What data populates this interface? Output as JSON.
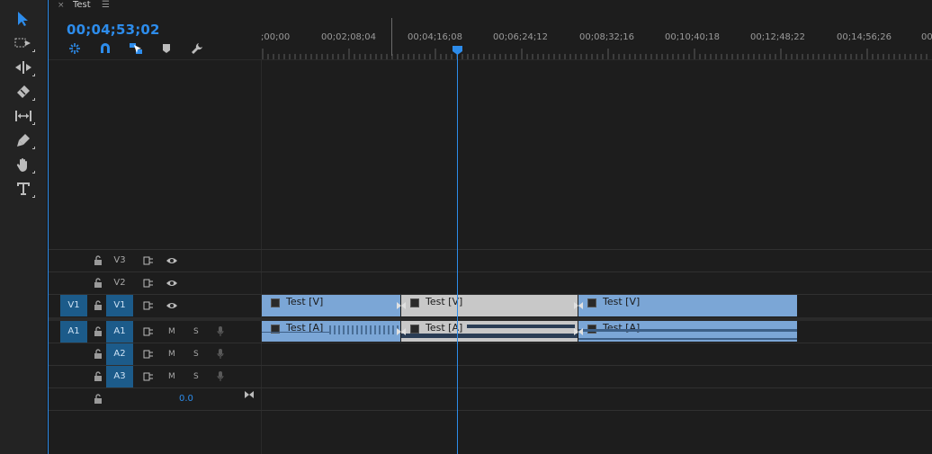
{
  "tools": [
    {
      "name": "selection-tool",
      "active": true
    },
    {
      "name": "track-select-tool",
      "active": false
    },
    {
      "name": "ripple-edit-tool",
      "active": false
    },
    {
      "name": "razor-tool",
      "active": false
    },
    {
      "name": "slip-tool",
      "active": false
    },
    {
      "name": "pen-tool",
      "active": false
    },
    {
      "name": "hand-tool",
      "active": false
    },
    {
      "name": "type-tool",
      "active": false
    }
  ],
  "panel": {
    "close_glyph": "×",
    "title": "Test",
    "menu_glyph": "☰"
  },
  "timecode": "00;04;53;02",
  "ruler": {
    "labels": [
      ";00;00",
      "00;02;08;04",
      "00;04;16;08",
      "00;06;24;12",
      "00;08;32;16",
      "00;10;40;18",
      "00;12;48;22",
      "00;14;56;26",
      "00"
    ]
  },
  "tracks": {
    "video": [
      {
        "label": "V3",
        "source": ""
      },
      {
        "label": "V2",
        "source": ""
      },
      {
        "label": "V1",
        "source": "V1"
      }
    ],
    "audio": [
      {
        "label": "A1",
        "source": "A1",
        "mute": "M",
        "solo": "S"
      },
      {
        "label": "A2",
        "source": "",
        "mute": "M",
        "solo": "S"
      },
      {
        "label": "A3",
        "source": "",
        "mute": "M",
        "solo": "S"
      }
    ],
    "master_value": "0.0"
  },
  "clips": {
    "video": [
      {
        "label": "Test [V]",
        "selected": false
      },
      {
        "label": "Test [V]",
        "selected": true
      },
      {
        "label": "Test [V]",
        "selected": false
      }
    ],
    "audio": [
      {
        "label": "Test [A]",
        "selected": false
      },
      {
        "label": "Test [A]",
        "selected": true
      },
      {
        "label": "Test [A]",
        "selected": false
      }
    ]
  },
  "colors": {
    "accent": "#2d8ceb",
    "clip": "#7ba6d6",
    "clip_selected": "#c8c8c8",
    "track_target": "#1c5b8a"
  }
}
